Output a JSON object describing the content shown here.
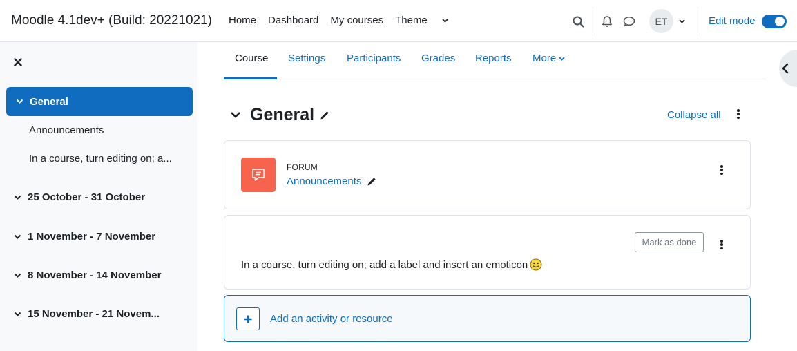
{
  "navbar": {
    "site_name": "Moodle 4.1dev+ (Build: 20221021)",
    "links": [
      "Home",
      "Dashboard",
      "My courses"
    ],
    "theme_label": "Theme",
    "avatar_initials": "ET",
    "edit_mode_label": "Edit mode",
    "edit_mode_on": true
  },
  "drawer": {
    "active_item": "General",
    "sub_items": [
      "Announcements",
      "In a course, turn editing on; a..."
    ],
    "sections": [
      "25 October - 31 October",
      "1 November - 7 November",
      "8 November - 14 November",
      "15 November - 21 Novem..."
    ]
  },
  "secondary_nav": {
    "tabs": [
      "Course",
      "Settings",
      "Participants",
      "Grades",
      "Reports"
    ],
    "more_label": "More",
    "active_tab": "Course"
  },
  "section": {
    "title": "General",
    "collapse_all_label": "Collapse all"
  },
  "activity": {
    "type": "FORUM",
    "name": "Announcements"
  },
  "label_activity": {
    "mark_done_label": "Mark as done",
    "text": "In a course, turn editing on; add a label and insert an emoticon"
  },
  "add_activity": {
    "label": "Add an activity or resource"
  },
  "colors": {
    "primary": "#0f6cbf",
    "forum_icon_bg": "#f7634d",
    "drawer_bg": "#f8f9fa"
  }
}
